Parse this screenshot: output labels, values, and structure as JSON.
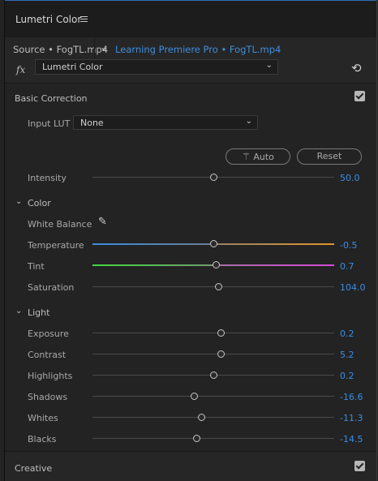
{
  "panel": {
    "title": "Lumetri Color",
    "menu_icon": "hamburger-menu-icon"
  },
  "source": {
    "clip": "Source • FogTL.mp4",
    "sequence_link": "Learning Premiere Pro • FogTL.mp4"
  },
  "effect": {
    "fx_label": "fx",
    "selected": "Lumetri Color"
  },
  "basic_correction": {
    "title": "Basic Correction",
    "enabled": true,
    "input_lut": {
      "label": "Input LUT",
      "value": "None"
    },
    "auto_label": "Auto",
    "reset_label": "Reset",
    "intensity": {
      "label": "Intensity",
      "value": "50.0",
      "fraction": 0.5
    }
  },
  "color": {
    "title": "Color",
    "white_balance_label": "White Balance",
    "sliders": [
      {
        "label": "Temperature",
        "value": "-0.5",
        "fraction": 0.5
      },
      {
        "label": "Tint",
        "value": "0.7",
        "fraction": 0.51
      },
      {
        "label": "Saturation",
        "value": "104.0",
        "fraction": 0.52
      }
    ],
    "temperature_colors": {
      "left": "#3b8de0",
      "right": "#e0962d"
    },
    "tint_colors": {
      "left": "#42d842",
      "right": "#d84ad8"
    }
  },
  "light": {
    "title": "Light",
    "sliders": [
      {
        "label": "Exposure",
        "value": "0.2",
        "fraction": 0.53
      },
      {
        "label": "Contrast",
        "value": "5.2",
        "fraction": 0.53
      },
      {
        "label": "Highlights",
        "value": "0.2",
        "fraction": 0.5
      },
      {
        "label": "Shadows",
        "value": "-16.6",
        "fraction": 0.42
      },
      {
        "label": "Whites",
        "value": "-11.3",
        "fraction": 0.45
      },
      {
        "label": "Blacks",
        "value": "-14.5",
        "fraction": 0.43
      }
    ]
  },
  "creative": {
    "title": "Creative",
    "enabled": true
  },
  "accent_color": "#3a8ee6"
}
